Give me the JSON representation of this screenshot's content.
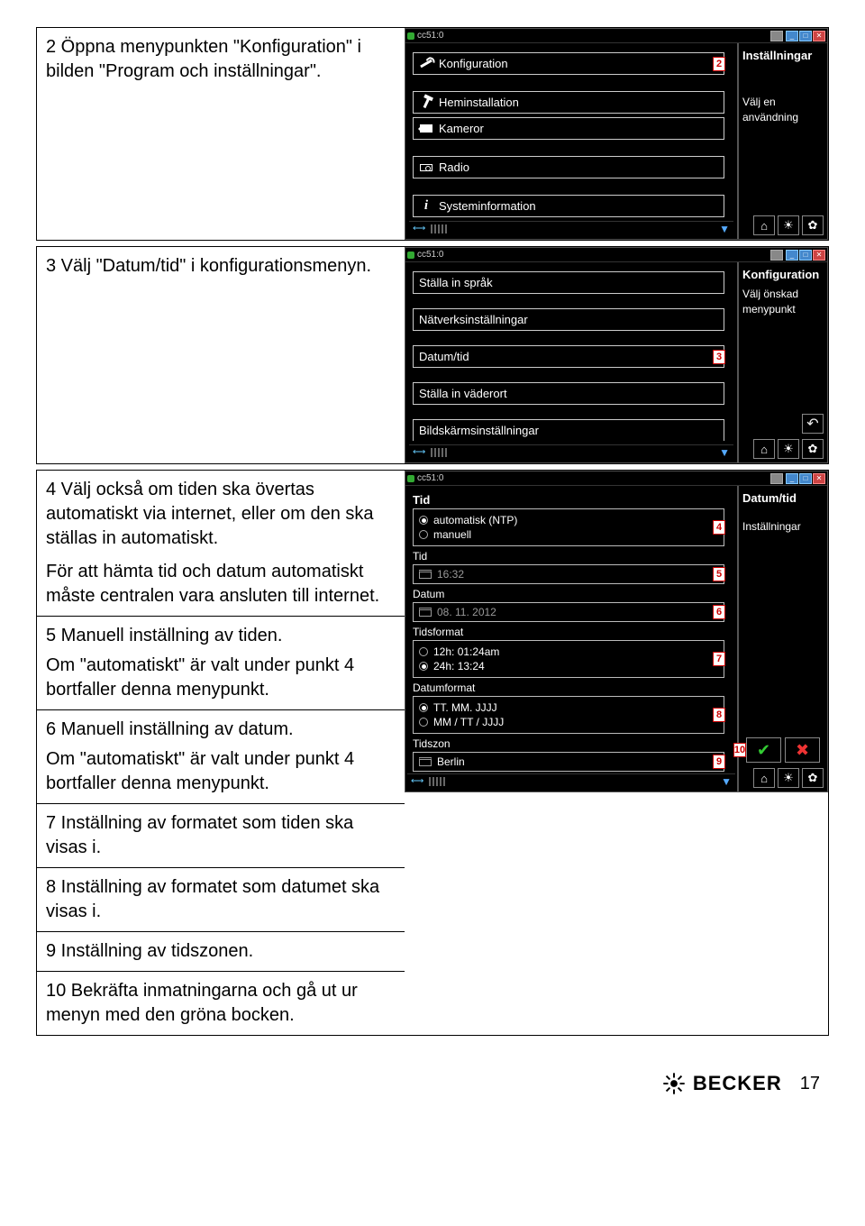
{
  "page_number": "17",
  "brand": "BECKER",
  "device_title": "cc51:0",
  "step2": {
    "text": "2 Öppna menypunkten \"Konfiguration\" i bilden \"Program och inställningar\".",
    "side_title": "Inställningar",
    "side_sub1": "Välj en",
    "side_sub2": "användning",
    "items": {
      "konfiguration": "Konfiguration",
      "heminstallation": "Heminstallation",
      "kameror": "Kameror",
      "radio": "Radio",
      "systeminfo": "Systeminformation"
    },
    "marker": "2"
  },
  "step3": {
    "text": "3 Välj \"Datum/tid\" i konfigurationsmenyn.",
    "side_title": "Konfiguration",
    "side_sub1": "Välj önskad",
    "side_sub2": "menypunkt",
    "items": {
      "sprak": "Ställa in språk",
      "natverk": "Nätverksinställningar",
      "datumtid": "Datum/tid",
      "vader": "Ställa in väderort",
      "bildskarm": "Bildskärmsinställningar"
    },
    "marker": "3"
  },
  "step4": {
    "p1": "4 Välj också om tiden ska övertas automatiskt via internet, eller om den ska ställas in automatiskt.",
    "p2": "För att hämta tid och datum automatiskt måste centralen vara ansluten till internet.",
    "c5a": "5 Manuell inställning av tiden.",
    "c5b": "Om \"automatiskt\" är valt under punkt 4 bortfaller denna menypunkt.",
    "c6a": "6 Manuell inställning av datum.",
    "c6b": "Om \"automatiskt\" är valt under punkt 4 bortfaller denna menypunkt.",
    "c7": "7 Inställning av formatet som tiden ska visas i.",
    "c8": "8 Inställning av formatet som datumet ska visas i.",
    "c9": "9 Inställning av tidszonen.",
    "c10": "10 Bekräfta inmatningarna och gå ut ur menyn med den gröna bocken.",
    "device": {
      "side_title": "Datum/tid",
      "side_sub": "Inställningar",
      "sec_tid": "Tid",
      "opt_auto": "automatisk (NTP)",
      "opt_manuell": "manuell",
      "lbl_tid": "Tid",
      "val_tid": "16:32",
      "lbl_datum": "Datum",
      "val_datum": "08. 11. 2012",
      "lbl_tidsformat": "Tidsformat",
      "opt_12h": "12h: 01:24am",
      "opt_24h": "24h: 13:24",
      "lbl_datumformat": "Datumformat",
      "opt_df1": "TT. MM. JJJJ",
      "opt_df2": "MM / TT / JJJJ",
      "lbl_tidszon": "Tidszon",
      "val_tidszon": "Berlin",
      "m4": "4",
      "m5": "5",
      "m6": "6",
      "m7": "7",
      "m8": "8",
      "m9": "9",
      "m10": "10"
    }
  }
}
